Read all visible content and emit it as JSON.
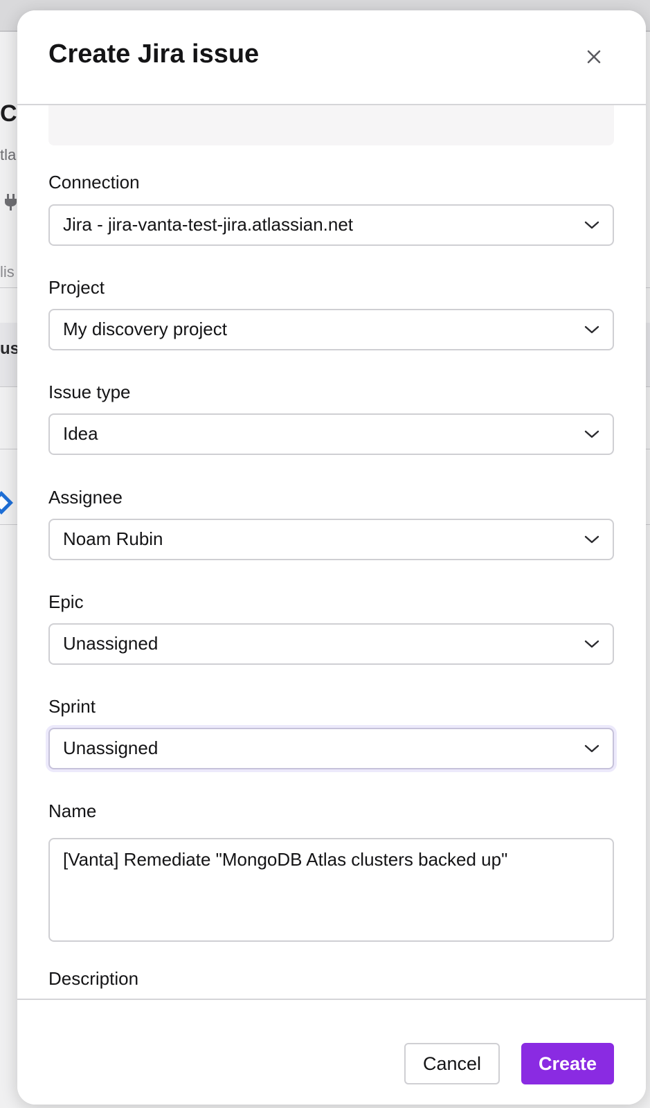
{
  "background": {
    "heading_fragment": "C",
    "subtitle_fragment": "tla",
    "plug_glyph": "⌁",
    "tab_fragment": "lis",
    "row_header_fragment": "us"
  },
  "modal": {
    "title": "Create Jira issue",
    "close_icon": "close-icon",
    "fields": {
      "connection": {
        "label": "Connection",
        "value": "Jira - jira-vanta-test-jira.atlassian.net"
      },
      "project": {
        "label": "Project",
        "value": "My discovery project"
      },
      "issue_type": {
        "label": "Issue type",
        "value": "Idea"
      },
      "assignee": {
        "label": "Assignee",
        "value": "Noam Rubin"
      },
      "epic": {
        "label": "Epic",
        "value": "Unassigned"
      },
      "sprint": {
        "label": "Sprint",
        "value": "Unassigned"
      },
      "name": {
        "label": "Name",
        "value": "[Vanta] Remediate \"MongoDB Atlas clusters backed up\""
      },
      "description": {
        "label": "Description"
      }
    },
    "footer": {
      "cancel_label": "Cancel",
      "create_label": "Create"
    }
  },
  "colors": {
    "primary": "#8a2be2",
    "focus_ring": "#ece9fb",
    "border": "#cfcfd3",
    "text": "#141416"
  }
}
